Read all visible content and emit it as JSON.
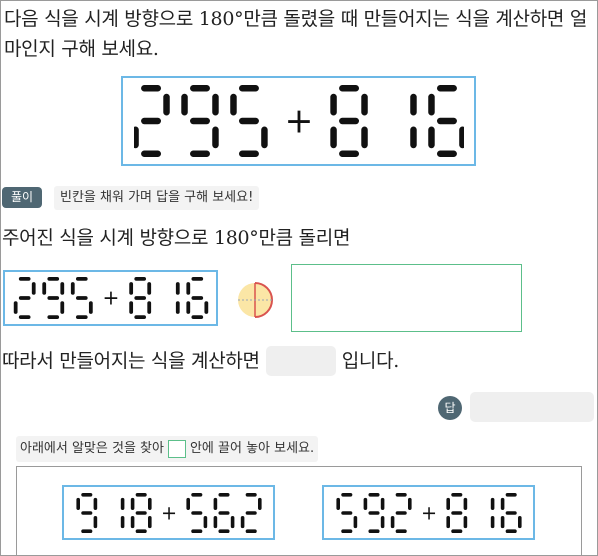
{
  "question": {
    "text": "다음 식을 시계 방향으로 180°만큼 돌렸을 때 만들어지는 식을 계산하면 얼마인지 구해 보세요."
  },
  "expression": {
    "left": "295",
    "op": "+",
    "right": "816"
  },
  "solution": {
    "badge": "풀이",
    "hint": "빈칸을 채워 가며 답을 구해 보세요!",
    "line_rotate": "주어진 식을 시계 방향으로 180°만큼 돌리면",
    "line_calc_before": "따라서 만들어지는 식을 계산하면",
    "line_calc_after": "입니다."
  },
  "answer": {
    "badge": "답",
    "value": ""
  },
  "drag": {
    "instruction_before": "아래에서 알맞은 것을 찾아",
    "instruction_after": "안에 끌어 놓아 보세요.",
    "choices": [
      {
        "left": "918",
        "op": "+",
        "right": "562"
      },
      {
        "left": "592",
        "op": "+",
        "right": "816"
      }
    ]
  },
  "colors": {
    "frame_blue": "#6cb8e6",
    "drop_green": "#5cbf8a",
    "badge_slate": "#4f6773",
    "blank_gray": "#efefef"
  },
  "icons": {
    "rotate": "rotate-half-circle-icon"
  }
}
